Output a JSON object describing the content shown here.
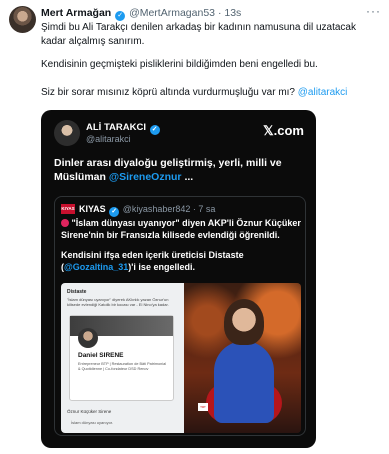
{
  "tweet": {
    "author_name": "Mert Armağan",
    "handle": "@MertArmagan53",
    "time": "· 13s",
    "more": "···",
    "verified_mark": "✓",
    "text_p1": "Şimdi bu Ali Tarakçı denilen arkadaş bir kadının namusuna dil uzatacak kadar alçalmış sanırım.",
    "text_p2": "Kendisinin geçmişteki pisliklerini bildiğimden beni engelledi bu.",
    "text_p3_prefix": "Siz bir sorar mısınız köprü altında vurdurmuşluğu var mı?",
    "text_p3_mention": "@alitarakci"
  },
  "embedded": {
    "name": "ALİ TARAKCI",
    "handle": "@alitarakci",
    "brand": "𝕏.com",
    "text": "Dinler arası diyaloğu geliştirmiş, yerli, milli ve Müslüman",
    "mention": "@SireneOznur",
    "ellipsis": "...",
    "quote": {
      "logo_text": "KIYAS",
      "name": "KIYAS",
      "handle": "@kiyashaber842 · 7 sa",
      "line1": "\"İslam dünyası uyanıyor\" diyen AKP'li Öznur Küçüker Sirene'nin bir Fransızla kilisede evlendiği öğrenildi.",
      "line2_prefix": "Kendisini ifşa eden içerik üreticisi Distaste (",
      "line2_mention": "@Gozaltina_31",
      "line2_suffix": ")'i ise engelledi.",
      "screenshot": {
        "header": "Distaste",
        "caption": "\"İslam dünyası uyanıyor\" diyerek AKlınlık yazan Öznur'un kilisede evlendiği Katolik bir kocası var - El Nino'ya kadar.",
        "profile_name": "Daniel SIRENE",
        "profile_desc": "Entrepreneur BTP | Restauration de Bâti Patrimonial & Quotidienne | Co-fondateur DSD Renov",
        "reply_name": "Öznur Küçüker Sirene",
        "reply_text": "İslam dünyası uyanıyor.",
        "mic_label": "TRT"
      }
    }
  }
}
